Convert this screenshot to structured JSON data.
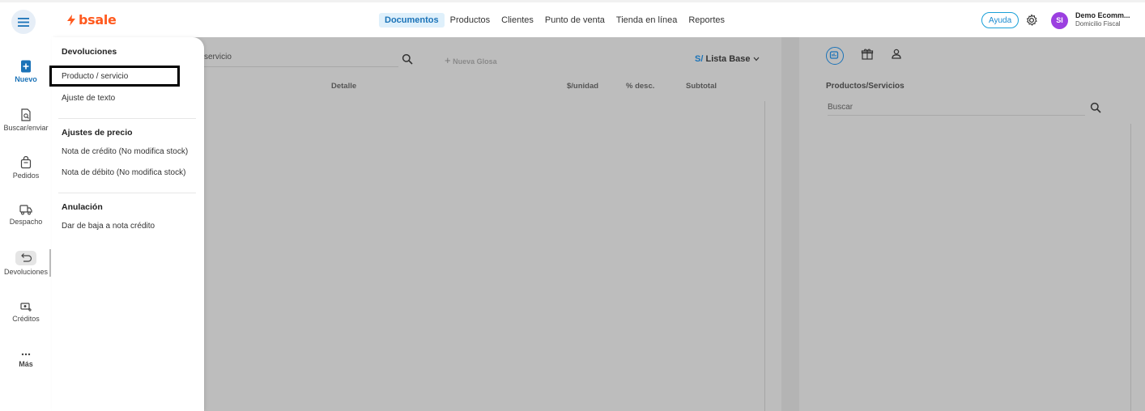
{
  "topbar": {
    "logo_text": "bsale",
    "nav": [
      "Documentos",
      "Productos",
      "Clientes",
      "Punto de venta",
      "Tienda en línea",
      "Reportes"
    ],
    "active_nav": "Documentos",
    "help_label": "Ayuda",
    "avatar_initials": "SI",
    "user_name": "Demo Ecomm...",
    "user_sub": "Domicilio Fiscal"
  },
  "rail": {
    "items": [
      {
        "label": "Nuevo",
        "icon": "new-doc-icon"
      },
      {
        "label": "Buscar/enviar",
        "icon": "search-doc-icon"
      },
      {
        "label": "Pedidos",
        "icon": "bag-icon"
      },
      {
        "label": "Despacho",
        "icon": "truck-icon"
      },
      {
        "label": "Devoluciones",
        "icon": "return-icon"
      },
      {
        "label": "Créditos",
        "icon": "credit-icon"
      },
      {
        "label": "Más",
        "icon": "more-icon"
      }
    ]
  },
  "dropdown": {
    "sections": [
      {
        "title": "Devoluciones",
        "items": [
          "Producto / servicio",
          "Ajuste de texto"
        ]
      },
      {
        "title": "Ajustes de precio",
        "items": [
          "Nota de crédito (No modifica stock)",
          "Nota de débito (No modifica stock)"
        ]
      },
      {
        "title": "Anulación",
        "items": [
          "Dar de baja a nota crédito"
        ]
      }
    ]
  },
  "main": {
    "search_value": "servicio",
    "nueva_glosa": "Nueva Glosa",
    "currency_symbol": "S/",
    "price_list": "Lista Base",
    "columns": [
      "Detalle",
      "$/unidad",
      "% desc.",
      "Subtotal"
    ]
  },
  "right_panel": {
    "title": "Productos/Servicios",
    "search_placeholder": "Buscar"
  },
  "colors": {
    "brand": "#ff5a1f",
    "accent": "#1b73b8",
    "overlay": "#bdbdbd"
  }
}
